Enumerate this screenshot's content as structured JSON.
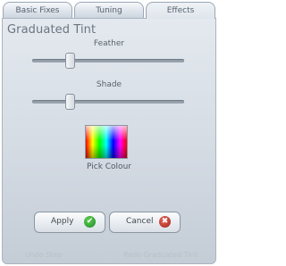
{
  "tabs": [
    "Basic Fixes",
    "Tuning",
    "Effects"
  ],
  "title": "Graduated Tint",
  "feather": {
    "label": "Feather",
    "value": 0.23
  },
  "shade": {
    "label": "Shade",
    "value": 0.23
  },
  "pick_colour_label": "Pick Colour",
  "buttons": {
    "apply": "Apply",
    "cancel": "Cancel"
  },
  "footer": {
    "left": "Undo Step",
    "right": "Redo Graduated Tint"
  },
  "colors": {
    "apply_icon": "#2e9b2f",
    "cancel_icon": "#c0392b"
  }
}
